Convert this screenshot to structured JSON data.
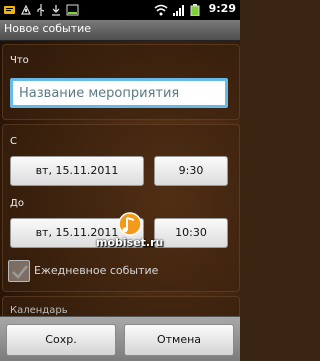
{
  "status_bar": {
    "time": "9:29",
    "icons": [
      "sms-icon",
      "android-debug-icon",
      "usb-icon",
      "download-icon",
      "battery-low-icon",
      "wifi-icon",
      "signal-icon",
      "battery-icon"
    ]
  },
  "app": {
    "title": "Новое событие"
  },
  "what": {
    "label": "Что",
    "input_placeholder": "Название мероприятия"
  },
  "from": {
    "label": "С",
    "date": "вт, 15.11.2011",
    "time": "9:30"
  },
  "to": {
    "label": "До",
    "date": "вт, 15.11.2011",
    "time": "10:30"
  },
  "all_day": {
    "label": "Ежедневное событие",
    "checked": true
  },
  "calendar": {
    "label": "Календарь"
  },
  "actions": {
    "save": "Сохр.",
    "cancel": "Отмена"
  },
  "watermark": "mobiset.ru",
  "colors": {
    "accent": "#66b9e8"
  }
}
